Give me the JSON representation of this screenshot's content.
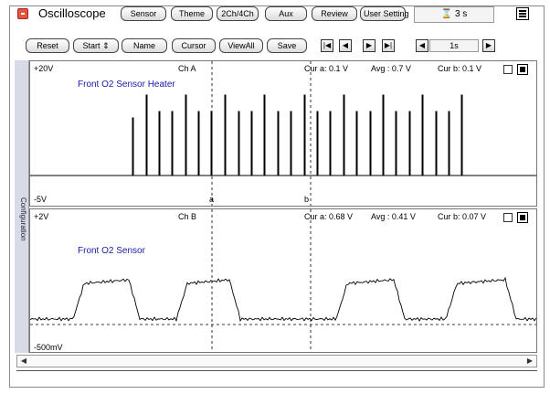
{
  "app": {
    "title": "Oscilloscope"
  },
  "toolbar1": {
    "sensor": "Sensor",
    "theme": "Theme",
    "channels": "2Ch/4Ch",
    "aux": "Aux",
    "review": "Review",
    "user_setting": "User Setting"
  },
  "time_display": "3 s",
  "toolbar2": {
    "reset": "Reset",
    "start": "Start",
    "name": "Name",
    "cursor": "Cursor",
    "viewall": "ViewAll",
    "save": "Save"
  },
  "playback": {
    "first": "|◀",
    "prev": "◀",
    "next": "▶",
    "last": "▶|",
    "rate_prev": "◀",
    "rate": "1s",
    "rate_next": "▶"
  },
  "sidebar": {
    "label": "Configuration"
  },
  "channel_a": {
    "ymax": "+20V",
    "ymin": "-5V",
    "name": "Ch A",
    "cur_a": "Cur a: 0.1 V",
    "avg": "Avg  : 0.7 V",
    "cur_b": "Cur b: 0.1 V",
    "signal": "Front O2 Sensor Heater",
    "cursor_a": "a",
    "cursor_b": "b"
  },
  "channel_b": {
    "ymax": "+2V",
    "ymin": "-500mV",
    "name": "Ch B",
    "cur_a": "Cur a: 0.68 V",
    "avg": "Avg  : 0.41 V",
    "cur_b": "Cur b: 0.07 V",
    "signal": "Front O2 Sensor"
  },
  "scrollbar": {
    "left": "◀",
    "right": "▶"
  },
  "colors": {
    "signal_label": "#1a1aa8",
    "trace": "#000000",
    "sidebar": "#d7dbe8"
  }
}
